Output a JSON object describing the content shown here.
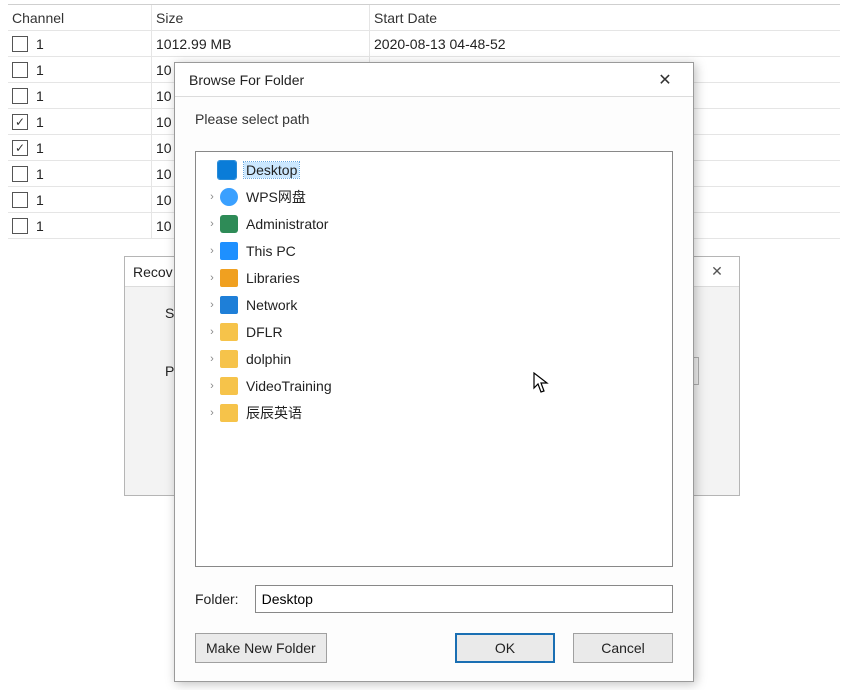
{
  "table": {
    "headers": {
      "channel": "Channel",
      "size": "Size",
      "start_date": "Start Date"
    },
    "rows": [
      {
        "checked": false,
        "channel": "1",
        "size": "1012.99 MB",
        "start_date": "2020-08-13 04-48-52"
      },
      {
        "checked": false,
        "channel": "1",
        "size": "10",
        "start_date": ""
      },
      {
        "checked": false,
        "channel": "1",
        "size": "10",
        "start_date": ""
      },
      {
        "checked": true,
        "channel": "1",
        "size": "10",
        "start_date": ""
      },
      {
        "checked": true,
        "channel": "1",
        "size": "10",
        "start_date": ""
      },
      {
        "checked": false,
        "channel": "1",
        "size": "10",
        "start_date": ""
      },
      {
        "checked": false,
        "channel": "1",
        "size": "10",
        "start_date": ""
      },
      {
        "checked": false,
        "channel": "1",
        "size": "10",
        "start_date": ""
      }
    ]
  },
  "recov_dialog": {
    "title": "Recov",
    "label_start": "St",
    "label_path": "Path",
    "browse_btn": "..."
  },
  "browse_dialog": {
    "title": "Browse For Folder",
    "subtitle": "Please select path",
    "tree": [
      {
        "label": "Desktop",
        "icon": "desktop",
        "expandable": false,
        "selected": true
      },
      {
        "label": "WPS网盘",
        "icon": "cloud",
        "expandable": true,
        "selected": false
      },
      {
        "label": "Administrator",
        "icon": "user",
        "expandable": true,
        "selected": false
      },
      {
        "label": "This PC",
        "icon": "pc",
        "expandable": true,
        "selected": false
      },
      {
        "label": "Libraries",
        "icon": "lib",
        "expandable": true,
        "selected": false
      },
      {
        "label": "Network",
        "icon": "net",
        "expandable": true,
        "selected": false
      },
      {
        "label": "DFLR",
        "icon": "folder",
        "expandable": true,
        "selected": false
      },
      {
        "label": "dolphin",
        "icon": "folder",
        "expandable": true,
        "selected": false
      },
      {
        "label": "VideoTraining",
        "icon": "folder",
        "expandable": true,
        "selected": false
      },
      {
        "label": "辰辰英语",
        "icon": "folder",
        "expandable": true,
        "selected": false
      }
    ],
    "folder_label": "Folder:",
    "folder_value": "Desktop",
    "buttons": {
      "make_new": "Make New Folder",
      "ok": "OK",
      "cancel": "Cancel"
    }
  }
}
